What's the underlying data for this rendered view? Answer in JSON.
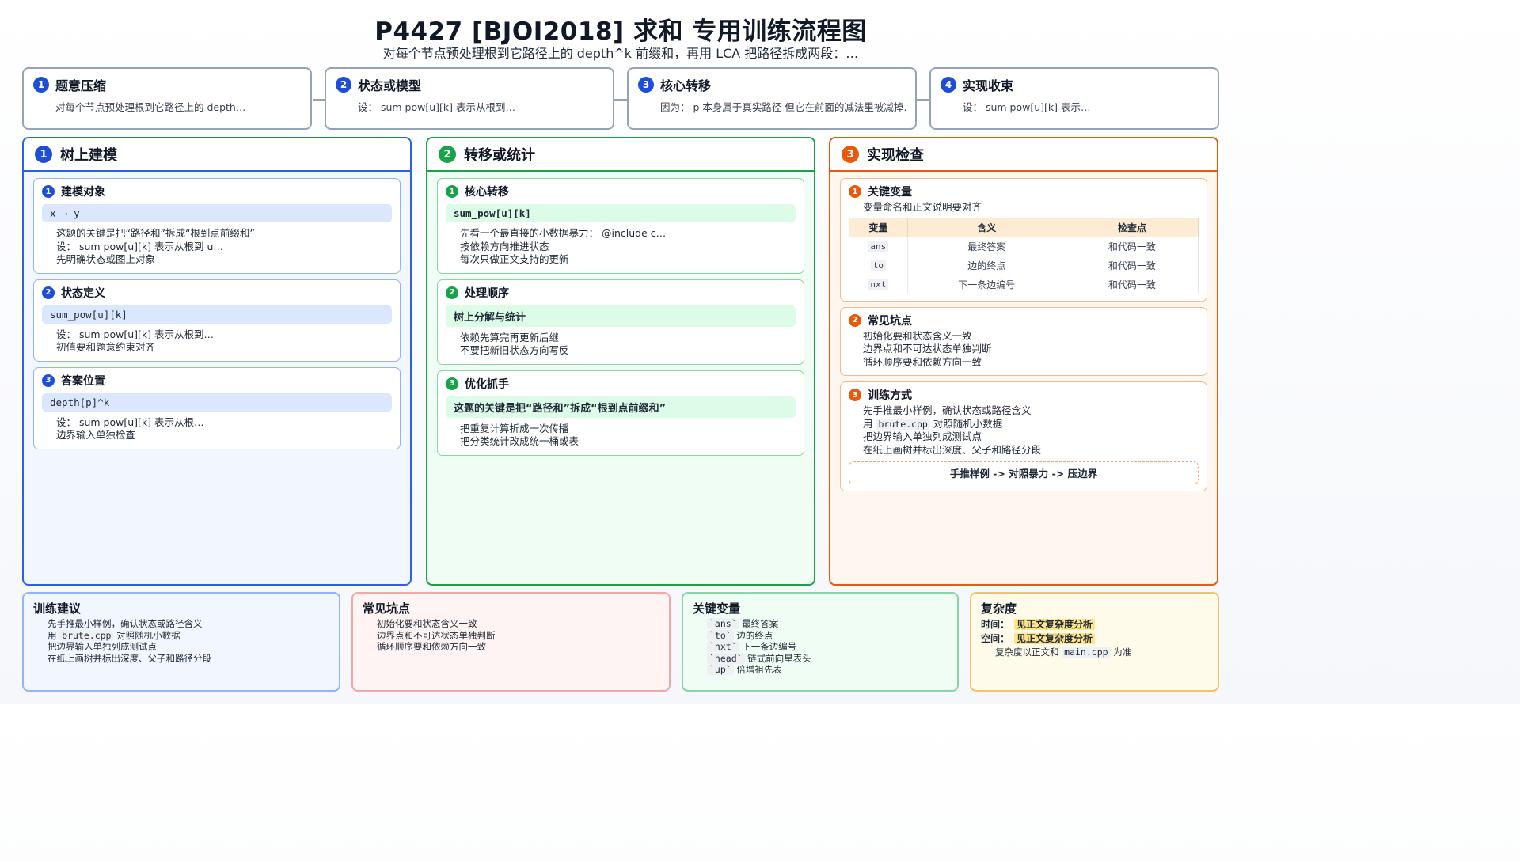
{
  "header": {
    "title": "P4427 [BJOI2018] 求和 专用训练流程图",
    "subtitle": "对每个节点预处理根到它路径上的 depth^k 前缀和，再用 LCA 把路径拆成两段：…"
  },
  "flow": [
    {
      "num": "1",
      "title": "题意压缩",
      "text": "对每个节点预处理根到它路径上的 depth…"
    },
    {
      "num": "2",
      "title": "状态或模型",
      "text": "设： sum pow[u][k] 表示从根到…"
    },
    {
      "num": "3",
      "title": "核心转移",
      "text": "因为： p 本身属于真实路径 但它在前面的减法里被减掉…"
    },
    {
      "num": "4",
      "title": "实现收束",
      "text": "设： sum pow[u][k] 表示…"
    }
  ],
  "col1": {
    "num": "1",
    "title": "树上建模",
    "cards": [
      {
        "num": "1",
        "title": "建模对象",
        "chip": "x → y",
        "items": [
          "这题的关键是把“路径和”拆成“根到点前缀和”",
          "设： sum pow[u][k] 表示从根到 u…",
          "先明确状态或图上对象"
        ]
      },
      {
        "num": "2",
        "title": "状态定义",
        "chip": "sum_pow[u][k]",
        "items": [
          "设： sum pow[u][k] 表示从根到…",
          "初值要和题意约束对齐"
        ]
      },
      {
        "num": "3",
        "title": "答案位置",
        "chip": "depth[p]^k",
        "items": [
          "设： sum pow[u][k] 表示从根…",
          "边界输入单独检查"
        ]
      }
    ]
  },
  "col2": {
    "num": "2",
    "title": "转移或统计",
    "cards": [
      {
        "num": "1",
        "title": "核心转移",
        "chip": "sum_pow[u][k]",
        "items": [
          "先看一个最直接的小数据暴力： @include c…",
          "按依赖方向推进状态",
          "每次只做正文支持的更新"
        ]
      },
      {
        "num": "2",
        "title": "处理顺序",
        "chip": "树上分解与统计",
        "items": [
          "依赖先算完再更新后继",
          "不要把新旧状态方向写反"
        ]
      },
      {
        "num": "3",
        "title": "优化抓手",
        "chip": "这题的关键是把“路径和”拆成“根到点前缀和”",
        "items": [
          "把重复计算折成一次传播",
          "把分类统计改成统一桶或表"
        ]
      }
    ]
  },
  "col3": {
    "num": "3",
    "title": "实现检查",
    "vars_card": {
      "num": "1",
      "title": "关键变量",
      "note": "变量命名和正文说明要对齐",
      "headers": [
        "变量",
        "含义",
        "检查点"
      ],
      "rows": [
        {
          "var": "ans",
          "meaning": "最终答案",
          "check": "和代码一致"
        },
        {
          "var": "to",
          "meaning": "边的终点",
          "check": "和代码一致"
        },
        {
          "var": "nxt",
          "meaning": "下一条边编号",
          "check": "和代码一致"
        }
      ]
    },
    "pitfall_card": {
      "num": "2",
      "title": "常见坑点",
      "items": [
        "初始化要和状态含义一致",
        "边界点和不可达状态单独判断",
        "循环顺序要和依赖方向一致"
      ]
    },
    "train_card": {
      "num": "3",
      "title": "训练方式",
      "item1": "先手推最小样例，确认状态或路径含义",
      "item2_pre": "用",
      "item2_code": "brute.cpp",
      "item2_post": "对照随机小数据",
      "item3": "把边界输入单独列成测试点",
      "item4": "在纸上画树并标出深度、父子和路径分段",
      "flow": "手推样例 -> 对照暴力 -> 压边界"
    }
  },
  "bottom": {
    "advice": {
      "title": "训练建议",
      "item1": "先手推最小样例，确认状态或路径含义",
      "item2_pre": "用",
      "item2_code": "brute.cpp",
      "item2_post": "对照随机小数据",
      "item3": "把边界输入单独列成测试点",
      "item4": "在纸上画树并标出深度、父子和路径分段"
    },
    "pitfalls": {
      "title": "常见坑点",
      "items": [
        "初始化要和状态含义一致",
        "边界点和不可达状态单独判断",
        "循环顺序要和依赖方向一致"
      ]
    },
    "vars": {
      "title": "关键变量",
      "items": [
        {
          "code": "`ans`",
          "text": "最终答案"
        },
        {
          "code": "`to`",
          "text": "边的终点"
        },
        {
          "code": "`nxt`",
          "text": "下一条边编号"
        },
        {
          "code": "`head`",
          "text": "链式前向星表头"
        },
        {
          "code": "`up`",
          "text": "倍增祖先表"
        }
      ]
    },
    "complexity": {
      "title": "复杂度",
      "time_label": "时间：",
      "time_value": "见正文复杂度分析",
      "space_label": "空间：",
      "space_value": "见正文复杂度分析",
      "note_pre": "复杂度以正文和",
      "note_code": "main.cpp",
      "note_post": "为准"
    }
  }
}
